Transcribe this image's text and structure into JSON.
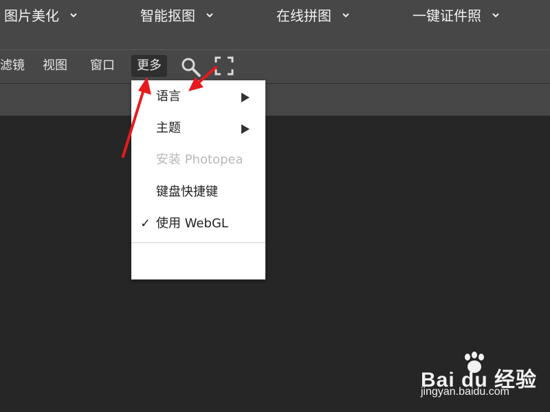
{
  "top_nav": {
    "items": [
      {
        "label": "图片美化"
      },
      {
        "label": "智能抠图"
      },
      {
        "label": "在线拼图"
      },
      {
        "label": "一键证件照"
      }
    ]
  },
  "menubar": {
    "items": [
      {
        "label": "滤镜"
      },
      {
        "label": "视图"
      },
      {
        "label": "窗口"
      },
      {
        "label": "更多",
        "active": true
      }
    ],
    "icons": [
      "search-icon",
      "fullscreen-icon"
    ]
  },
  "dropdown": {
    "items": [
      {
        "label": "语言",
        "submenu": true
      },
      {
        "label": "主题",
        "submenu": true
      },
      {
        "label": "安装 Photopea",
        "disabled": true
      },
      {
        "label": "键盘快捷键"
      },
      {
        "label": "使用 WebGL",
        "checked": true,
        "check_mark": "✓"
      }
    ]
  },
  "watermark": {
    "brand": "Bai du 经验",
    "url": "jingyan.baidu.com"
  },
  "colors": {
    "nav_bg": "#474747",
    "workspace_bg": "#262626",
    "dropdown_bg": "#ffffff",
    "annotation_arrow": "#e8191c"
  }
}
